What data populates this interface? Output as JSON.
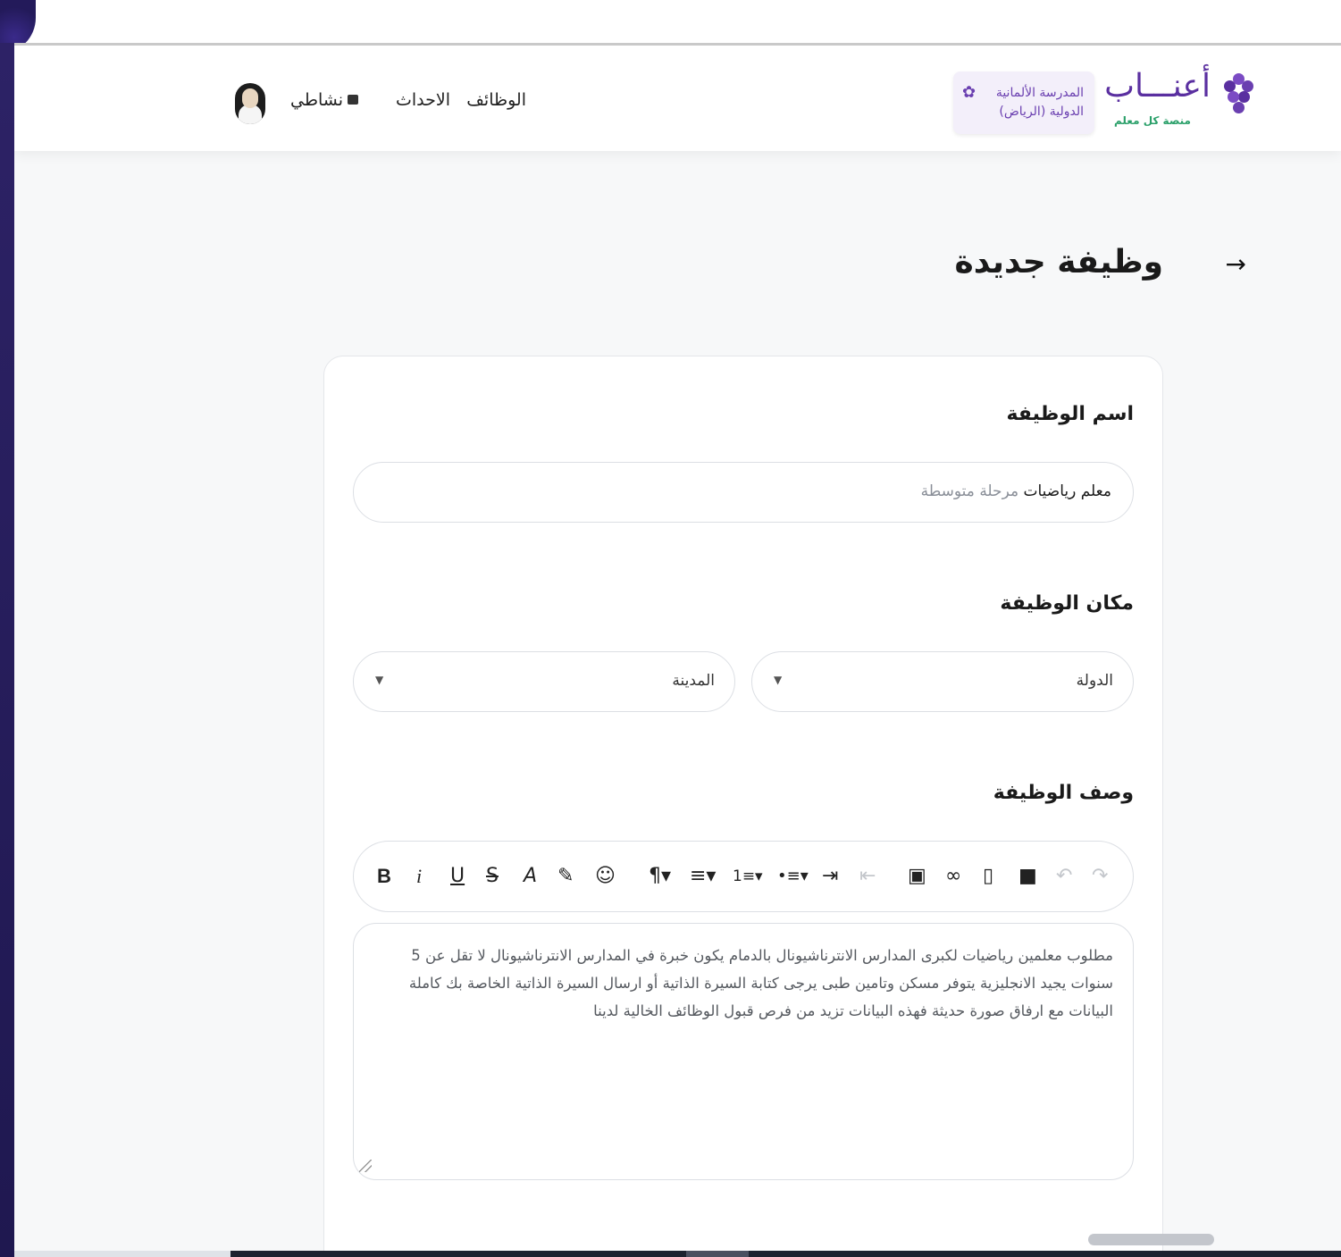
{
  "header": {
    "logo_word": "أعنـــاب",
    "logo_tagline": "منصة كل معلم",
    "school_name_line1": "المدرسة الألمانية",
    "school_name_line2": "الدولية (الرياض)",
    "nav": {
      "jobs": "الوظائف",
      "events": "الاحداث",
      "activity": "نشاطي"
    },
    "icons": {
      "settings": "gear-icon",
      "activity": "briefcase-icon",
      "brand": "grapes-logo-icon"
    }
  },
  "page": {
    "title": "وظيفة جديدة",
    "back_icon": "arrow-right-icon"
  },
  "form": {
    "job_name_label": "اسم الوظيفة",
    "job_name_value_main": "معلم رياضيات",
    "job_name_value_suffix": "مرحلة متوسطة",
    "job_location_label": "مكان الوظيفة",
    "country_placeholder": "الدولة",
    "city_placeholder": "المدينة",
    "job_description_label": "وصف الوظيفة",
    "description_text": "مطلوب معلمين رياضيات لكبرى المدارس الانترناشيونال بالدمام يكون خبرة في المدارس الانترناشيونال لا تقل عن 5 سنوات يجيد الانجليزية يتوفر مسكن وتامين طبى يرجى كتابة السيرة الذاتية أو ارسال السيرة الذاتية الخاصة بك كاملة البيانات مع ارفاق صورة حديثة فهذه البيانات تزيد من فرص قبول الوظائف الخالية لدينا",
    "toolbar": {
      "bold": "B",
      "italic": "i",
      "underline": "U",
      "strikethrough": "S",
      "text_color": "A",
      "paragraph": "¶▾",
      "align": "≡▾",
      "ordered_list": "1≡▾",
      "unordered_list": "•≡▾"
    }
  },
  "colors": {
    "brand_purple": "#6a3fb0",
    "brand_green": "#2ba06a",
    "badge_bg": "#f3effa"
  }
}
